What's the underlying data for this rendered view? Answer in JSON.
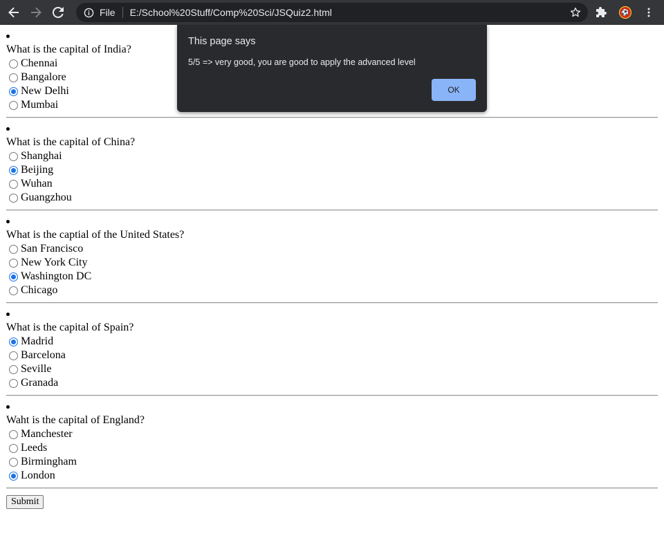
{
  "browser": {
    "scheme_label": "File",
    "url": "E:/School%20Stuff/Comp%20Sci/JSQuiz2.html"
  },
  "questions": [
    {
      "text": "What is the capital of India?",
      "options": [
        "Chennai",
        "Bangalore",
        "New Delhi",
        "Mumbai"
      ],
      "selected": 2
    },
    {
      "text": "What is the capital of China?",
      "options": [
        "Shanghai",
        "Beijing",
        "Wuhan",
        "Guangzhou"
      ],
      "selected": 1
    },
    {
      "text": "What is the captial of the United States?",
      "options": [
        "San Francisco",
        "New York City",
        "Washington DC",
        "Chicago"
      ],
      "selected": 2
    },
    {
      "text": "What is the capital of Spain?",
      "options": [
        "Madrid",
        "Barcelona",
        "Seville",
        "Granada"
      ],
      "selected": 0
    },
    {
      "text": "Waht is the capital of England?",
      "options": [
        "Manchester",
        "Leeds",
        "Birmingham",
        "London"
      ],
      "selected": 3
    }
  ],
  "submit_label": "Submit",
  "dialog": {
    "title": "This page says",
    "message": "5/5 => very good, you are good to apply the advanced level",
    "ok_label": "OK"
  },
  "colors": {
    "chrome_bg": "#35363a",
    "dialog_bg": "#292a2d",
    "dialog_button": "#8ab4f8",
    "radio_checked": "#1a73e8"
  }
}
